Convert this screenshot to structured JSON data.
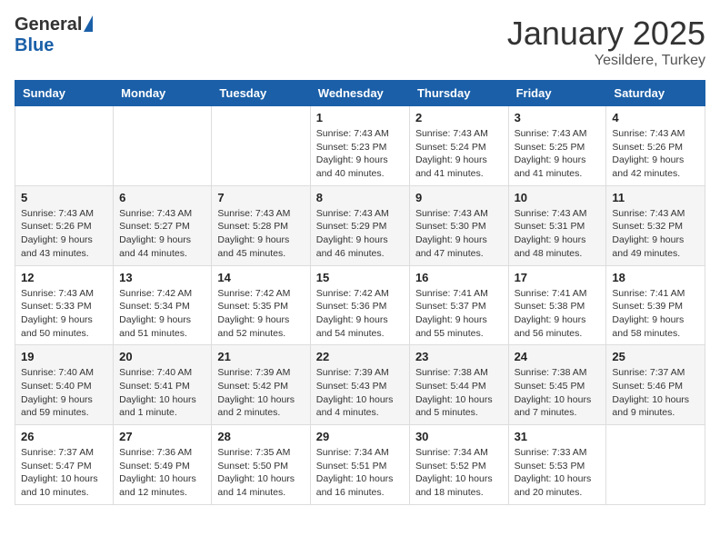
{
  "header": {
    "logo_general": "General",
    "logo_blue": "Blue",
    "title": "January 2025",
    "subtitle": "Yesildere, Turkey"
  },
  "columns": [
    "Sunday",
    "Monday",
    "Tuesday",
    "Wednesday",
    "Thursday",
    "Friday",
    "Saturday"
  ],
  "weeks": [
    [
      {
        "day": "",
        "info": ""
      },
      {
        "day": "",
        "info": ""
      },
      {
        "day": "",
        "info": ""
      },
      {
        "day": "1",
        "info": "Sunrise: 7:43 AM\nSunset: 5:23 PM\nDaylight: 9 hours\nand 40 minutes."
      },
      {
        "day": "2",
        "info": "Sunrise: 7:43 AM\nSunset: 5:24 PM\nDaylight: 9 hours\nand 41 minutes."
      },
      {
        "day": "3",
        "info": "Sunrise: 7:43 AM\nSunset: 5:25 PM\nDaylight: 9 hours\nand 41 minutes."
      },
      {
        "day": "4",
        "info": "Sunrise: 7:43 AM\nSunset: 5:26 PM\nDaylight: 9 hours\nand 42 minutes."
      }
    ],
    [
      {
        "day": "5",
        "info": "Sunrise: 7:43 AM\nSunset: 5:26 PM\nDaylight: 9 hours\nand 43 minutes."
      },
      {
        "day": "6",
        "info": "Sunrise: 7:43 AM\nSunset: 5:27 PM\nDaylight: 9 hours\nand 44 minutes."
      },
      {
        "day": "7",
        "info": "Sunrise: 7:43 AM\nSunset: 5:28 PM\nDaylight: 9 hours\nand 45 minutes."
      },
      {
        "day": "8",
        "info": "Sunrise: 7:43 AM\nSunset: 5:29 PM\nDaylight: 9 hours\nand 46 minutes."
      },
      {
        "day": "9",
        "info": "Sunrise: 7:43 AM\nSunset: 5:30 PM\nDaylight: 9 hours\nand 47 minutes."
      },
      {
        "day": "10",
        "info": "Sunrise: 7:43 AM\nSunset: 5:31 PM\nDaylight: 9 hours\nand 48 minutes."
      },
      {
        "day": "11",
        "info": "Sunrise: 7:43 AM\nSunset: 5:32 PM\nDaylight: 9 hours\nand 49 minutes."
      }
    ],
    [
      {
        "day": "12",
        "info": "Sunrise: 7:43 AM\nSunset: 5:33 PM\nDaylight: 9 hours\nand 50 minutes."
      },
      {
        "day": "13",
        "info": "Sunrise: 7:42 AM\nSunset: 5:34 PM\nDaylight: 9 hours\nand 51 minutes."
      },
      {
        "day": "14",
        "info": "Sunrise: 7:42 AM\nSunset: 5:35 PM\nDaylight: 9 hours\nand 52 minutes."
      },
      {
        "day": "15",
        "info": "Sunrise: 7:42 AM\nSunset: 5:36 PM\nDaylight: 9 hours\nand 54 minutes."
      },
      {
        "day": "16",
        "info": "Sunrise: 7:41 AM\nSunset: 5:37 PM\nDaylight: 9 hours\nand 55 minutes."
      },
      {
        "day": "17",
        "info": "Sunrise: 7:41 AM\nSunset: 5:38 PM\nDaylight: 9 hours\nand 56 minutes."
      },
      {
        "day": "18",
        "info": "Sunrise: 7:41 AM\nSunset: 5:39 PM\nDaylight: 9 hours\nand 58 minutes."
      }
    ],
    [
      {
        "day": "19",
        "info": "Sunrise: 7:40 AM\nSunset: 5:40 PM\nDaylight: 9 hours\nand 59 minutes."
      },
      {
        "day": "20",
        "info": "Sunrise: 7:40 AM\nSunset: 5:41 PM\nDaylight: 10 hours\nand 1 minute."
      },
      {
        "day": "21",
        "info": "Sunrise: 7:39 AM\nSunset: 5:42 PM\nDaylight: 10 hours\nand 2 minutes."
      },
      {
        "day": "22",
        "info": "Sunrise: 7:39 AM\nSunset: 5:43 PM\nDaylight: 10 hours\nand 4 minutes."
      },
      {
        "day": "23",
        "info": "Sunrise: 7:38 AM\nSunset: 5:44 PM\nDaylight: 10 hours\nand 5 minutes."
      },
      {
        "day": "24",
        "info": "Sunrise: 7:38 AM\nSunset: 5:45 PM\nDaylight: 10 hours\nand 7 minutes."
      },
      {
        "day": "25",
        "info": "Sunrise: 7:37 AM\nSunset: 5:46 PM\nDaylight: 10 hours\nand 9 minutes."
      }
    ],
    [
      {
        "day": "26",
        "info": "Sunrise: 7:37 AM\nSunset: 5:47 PM\nDaylight: 10 hours\nand 10 minutes."
      },
      {
        "day": "27",
        "info": "Sunrise: 7:36 AM\nSunset: 5:49 PM\nDaylight: 10 hours\nand 12 minutes."
      },
      {
        "day": "28",
        "info": "Sunrise: 7:35 AM\nSunset: 5:50 PM\nDaylight: 10 hours\nand 14 minutes."
      },
      {
        "day": "29",
        "info": "Sunrise: 7:34 AM\nSunset: 5:51 PM\nDaylight: 10 hours\nand 16 minutes."
      },
      {
        "day": "30",
        "info": "Sunrise: 7:34 AM\nSunset: 5:52 PM\nDaylight: 10 hours\nand 18 minutes."
      },
      {
        "day": "31",
        "info": "Sunrise: 7:33 AM\nSunset: 5:53 PM\nDaylight: 10 hours\nand 20 minutes."
      },
      {
        "day": "",
        "info": ""
      }
    ]
  ]
}
